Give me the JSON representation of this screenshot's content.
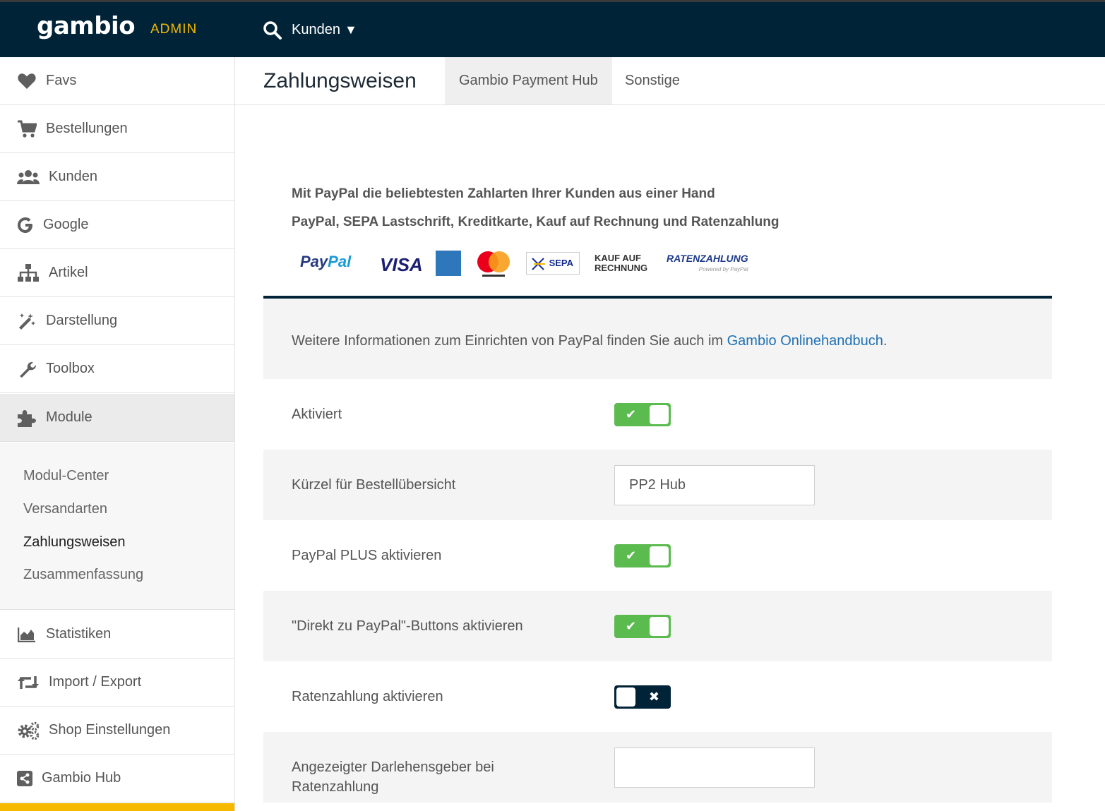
{
  "header": {
    "logo_text": "gambio",
    "admin_label": "ADMIN",
    "search_scope": "Kunden"
  },
  "sidebar": {
    "items": [
      {
        "label": "Favs",
        "icon": "heart-icon"
      },
      {
        "label": "Bestellungen",
        "icon": "cart-icon"
      },
      {
        "label": "Kunden",
        "icon": "users-icon"
      },
      {
        "label": "Google",
        "icon": "google-icon"
      },
      {
        "label": "Artikel",
        "icon": "sitemap-icon"
      },
      {
        "label": "Darstellung",
        "icon": "magic-wand-icon"
      },
      {
        "label": "Toolbox",
        "icon": "wrench-icon"
      },
      {
        "label": "Module",
        "icon": "puzzle-icon"
      },
      {
        "label": "Statistiken",
        "icon": "area-chart-icon"
      },
      {
        "label": "Import / Export",
        "icon": "retweet-icon"
      },
      {
        "label": "Shop Einstellungen",
        "icon": "gears-icon"
      },
      {
        "label": "Gambio Hub",
        "icon": "share-icon"
      }
    ],
    "submenu": [
      "Modul-Center",
      "Versandarten",
      "Zahlungsweisen",
      "Zusammenfassung"
    ]
  },
  "page": {
    "title": "Zahlungsweisen",
    "tabs": [
      "Gambio Payment Hub",
      "Sonstige"
    ]
  },
  "promo": {
    "line1": "Mit PayPal die beliebtesten Zahlarten Ihrer Kunden aus einer Hand",
    "line2": "PayPal, SEPA Lastschrift, Kreditkarte, Kauf auf Rechnung und Ratenzahlung",
    "logos": {
      "paypal_a": "Pay",
      "paypal_b": "Pal",
      "visa": "VISA",
      "sepa": "SEPA",
      "kauf_1": "KAUF AUF",
      "kauf_2": "RECHNUNG",
      "raten": "RATENZAHLUNG",
      "raten_small": "Powered by PayPal"
    }
  },
  "info": {
    "text": "Weitere Informationen zum Einrichten von PayPal finden Sie auch im ",
    "link": "Gambio Onlinehandbuch",
    "suffix": "."
  },
  "settings": {
    "aktiviert": {
      "label": "Aktiviert",
      "on": true
    },
    "kuerzel": {
      "label": "Kürzel für Bestellübersicht",
      "value": "PP2 Hub"
    },
    "plus": {
      "label": "PayPal PLUS aktivieren",
      "on": true
    },
    "direkt": {
      "label": "\"Direkt zu PayPal\"-Buttons aktivieren",
      "on": true
    },
    "raten": {
      "label": "Ratenzahlung aktivieren",
      "on": false
    },
    "darlehen": {
      "label1": "Angezeigter Darlehensgeber bei",
      "label2": "Ratenzahlung",
      "value": ""
    }
  },
  "colors": {
    "topbar": "#002337",
    "accent": "#f6b900",
    "switch_on": "#5cbb4f",
    "switch_off": "#002337",
    "link": "#2071b5"
  }
}
